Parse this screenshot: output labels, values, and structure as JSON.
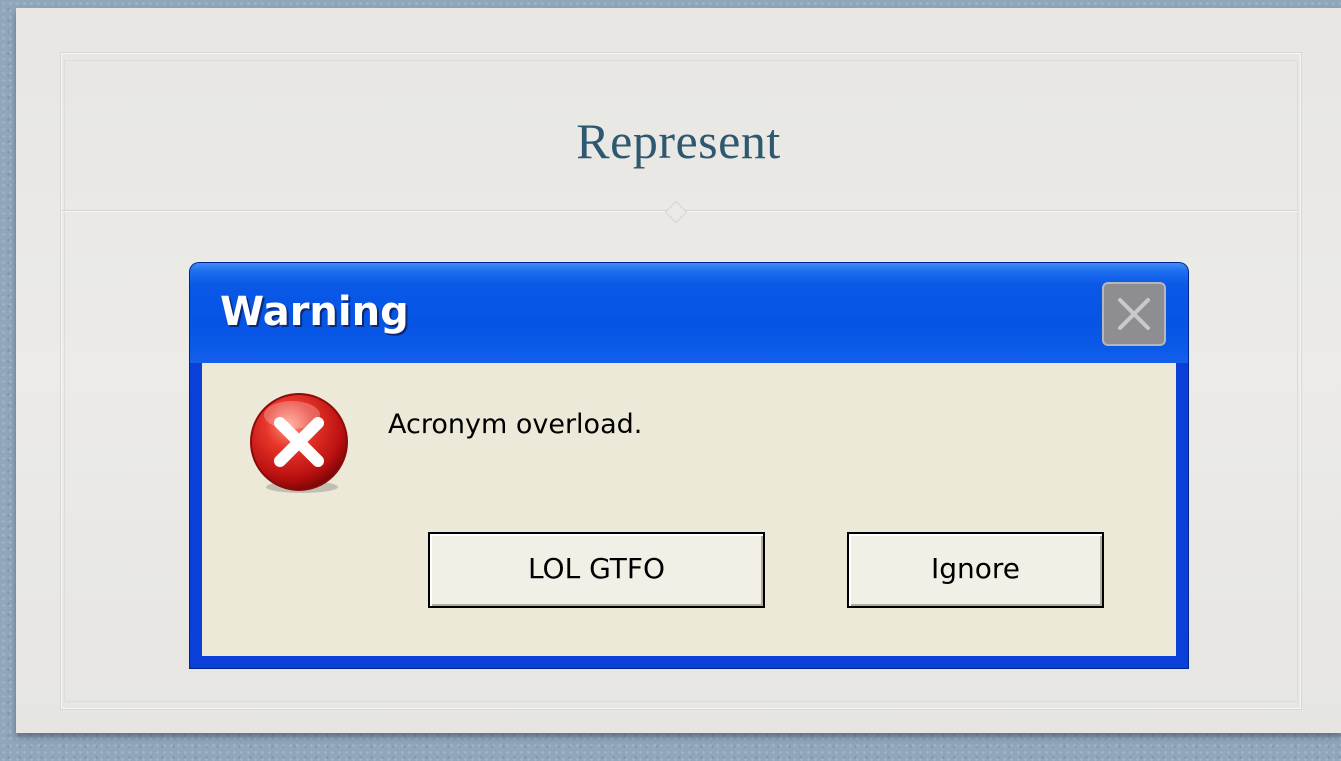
{
  "slide": {
    "title": "Represent"
  },
  "dialog": {
    "title": "Warning",
    "message": "Acronym overload.",
    "icon": "error-icon",
    "close_icon": "close-icon",
    "buttons": [
      {
        "label": "LOL GTFO"
      },
      {
        "label": "Ignore"
      }
    ]
  },
  "colors": {
    "title_text": "#2e5870",
    "titlebar_blue": "#0654e4",
    "dialog_body": "#ece9d8",
    "error_red": "#d81818"
  }
}
